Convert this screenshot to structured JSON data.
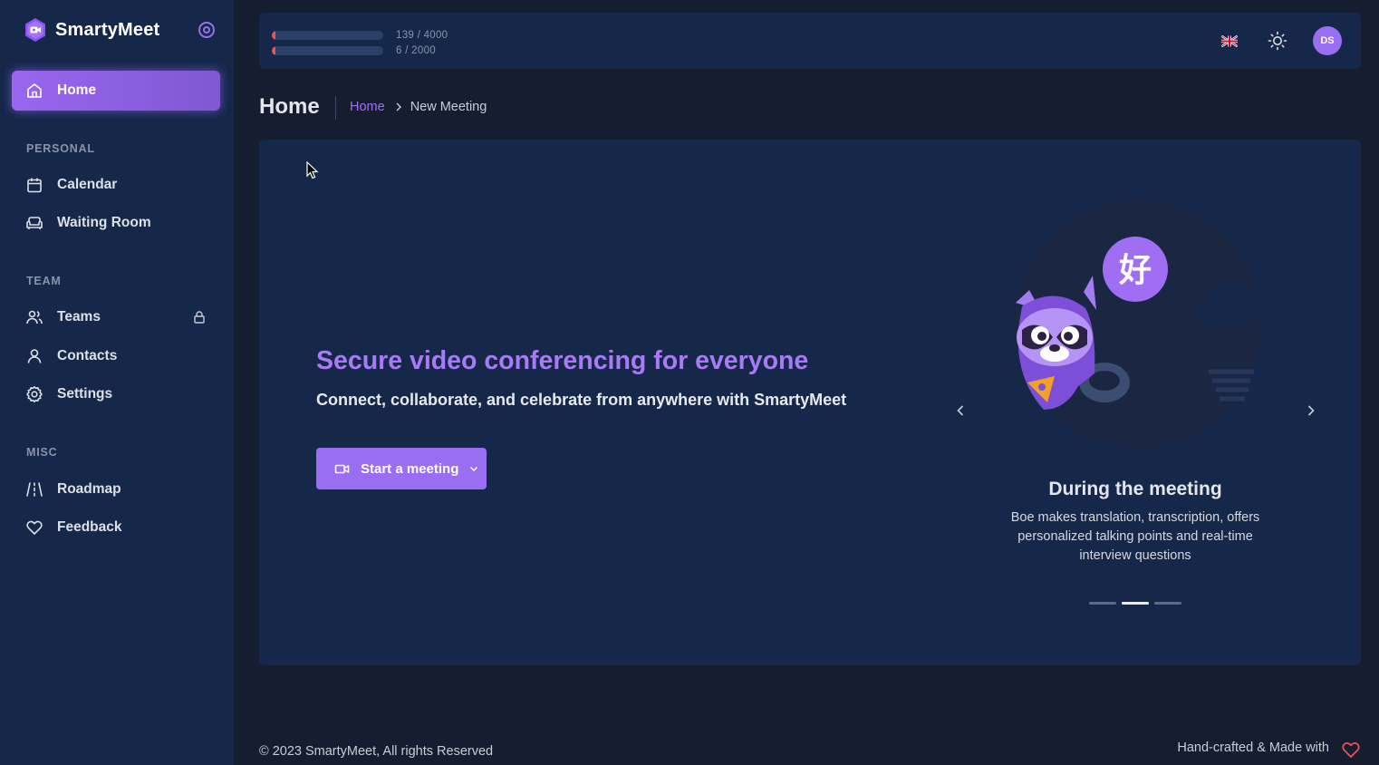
{
  "brand": {
    "name": "SmartyMeet"
  },
  "sidebar": {
    "home_label": "Home",
    "sections": [
      {
        "title": "PERSONAL",
        "items": [
          {
            "label": "Calendar",
            "icon": "calendar-icon"
          },
          {
            "label": "Waiting Room",
            "icon": "couch-icon"
          }
        ]
      },
      {
        "title": "TEAM",
        "items": [
          {
            "label": "Teams",
            "icon": "users-icon",
            "locked": true
          },
          {
            "label": "Contacts",
            "icon": "user-icon"
          },
          {
            "label": "Settings",
            "icon": "gear-icon"
          }
        ]
      },
      {
        "title": "MISC",
        "items": [
          {
            "label": "Roadmap",
            "icon": "road-icon"
          },
          {
            "label": "Feedback",
            "icon": "heart-icon"
          }
        ]
      }
    ]
  },
  "topbar": {
    "usage": [
      {
        "text": "139 / 4000",
        "fraction": 0.035
      },
      {
        "text": "6 / 2000",
        "fraction": 0.003
      }
    ],
    "avatar_initials": "DS"
  },
  "page": {
    "title": "Home",
    "breadcrumb": {
      "link": "Home",
      "current": "New Meeting"
    }
  },
  "hero": {
    "title": "Secure video conferencing for everyone",
    "subtitle": "Connect, collaborate, and celebrate from anywhere with SmartyMeet",
    "button_label": "Start a meeting"
  },
  "carousel": {
    "badge_char": "好",
    "slide_title": "During the meeting",
    "slide_desc": "Boe makes translation, transcription, offers personalized talking points and real-time interview questions",
    "dots": 3,
    "active_index": 1
  },
  "footer": {
    "copyright": "© 2023 SmartyMeet, All rights Reserved",
    "handmade": "Hand-crafted & Made with"
  },
  "colors": {
    "accent": "#9a6ef2",
    "sidebar_bg": "#15284a",
    "page_bg": "#161d31",
    "danger": "#ea5455"
  }
}
